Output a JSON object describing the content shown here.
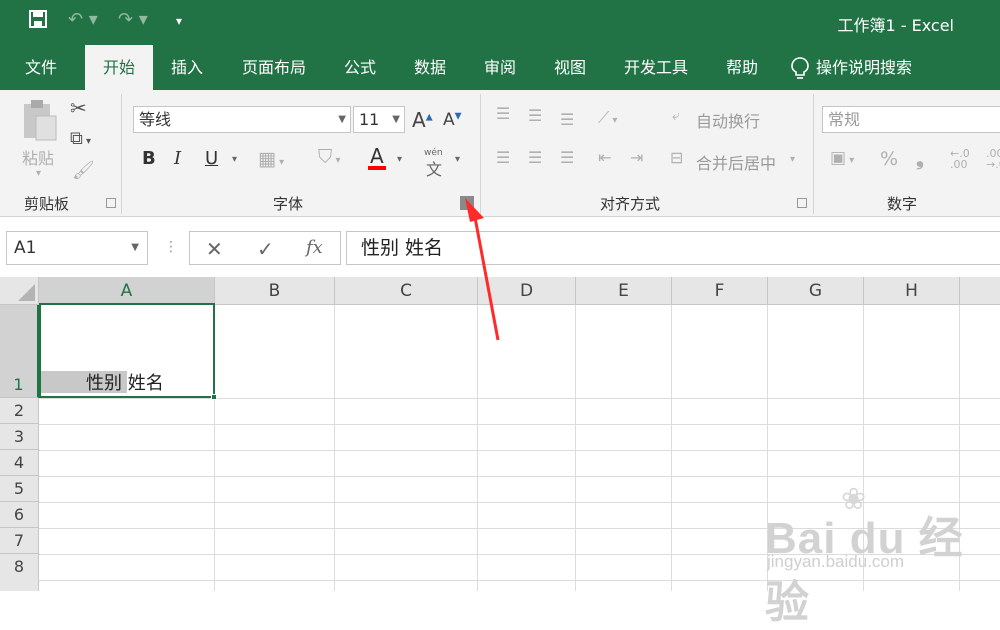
{
  "window": {
    "title": "工作簿1  -  Excel"
  },
  "quick_access": {
    "save_icon": "save-icon",
    "undo_icon": "undo-icon",
    "redo_icon": "redo-icon",
    "customize_icon": "customize-icon"
  },
  "tabs": [
    {
      "label": "文件"
    },
    {
      "label": "开始"
    },
    {
      "label": "插入"
    },
    {
      "label": "页面布局"
    },
    {
      "label": "公式"
    },
    {
      "label": "数据"
    },
    {
      "label": "审阅"
    },
    {
      "label": "视图"
    },
    {
      "label": "开发工具"
    },
    {
      "label": "帮助"
    },
    {
      "label": "操作说明搜索"
    }
  ],
  "ribbon": {
    "clipboard": {
      "label": "剪贴板",
      "paste_label": "粘贴"
    },
    "font": {
      "label": "字体",
      "font_name": "等线",
      "font_size": "11",
      "bold": "B",
      "italic": "I",
      "underline": "U",
      "color_letter": "A",
      "phonetic_top": "wén",
      "phonetic_char": "文",
      "grow": "A",
      "shrink": "A",
      "accent_color": "#ff0000"
    },
    "alignment": {
      "label": "对齐方式",
      "wrap_text": "自动换行",
      "merge_center": "合并后居中"
    },
    "number": {
      "label": "数字",
      "format": "常规",
      "percent": "%",
      "comma": "❟",
      "inc_dec": ".00",
      "inc_dec2": "←.0"
    }
  },
  "formula_bar": {
    "name_box": "A1",
    "cancel": "✕",
    "enter": "✓",
    "fx": "fx",
    "content": "性别 姓名"
  },
  "grid": {
    "columns": [
      "A",
      "B",
      "C",
      "D",
      "E",
      "F",
      "G",
      "H"
    ],
    "rows": [
      "1",
      "2",
      "3",
      "4",
      "5",
      "6",
      "7",
      "8"
    ],
    "selected_cell_text": "性别 姓名"
  },
  "watermark": {
    "brand": "Bai du 经验",
    "url": "jingyan.baidu.com"
  },
  "colors": {
    "excel_green": "#217346",
    "arrow_red": "#ff2a2a"
  }
}
